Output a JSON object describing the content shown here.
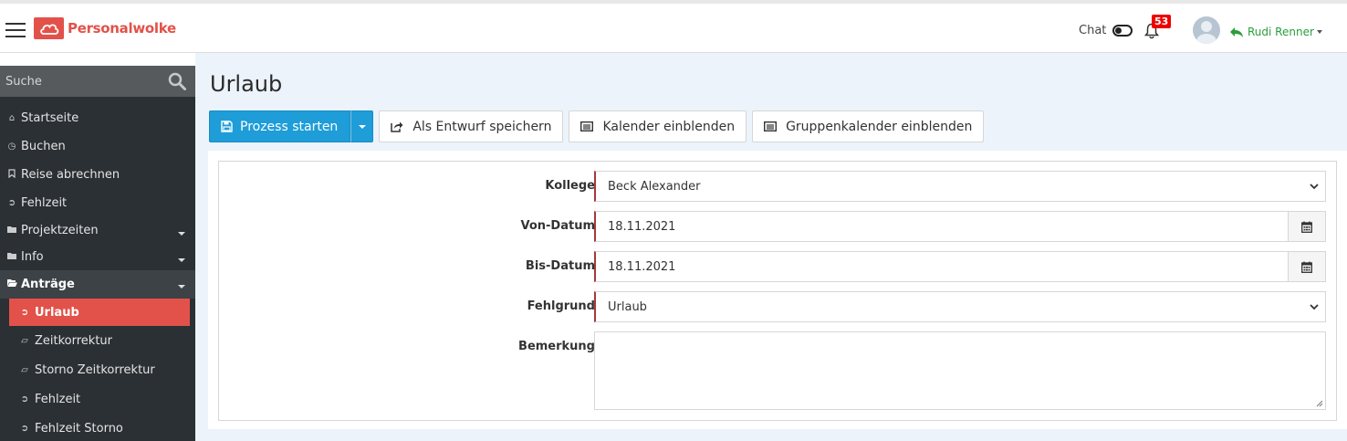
{
  "header": {
    "brand": "Personalwolke",
    "chat_label": "Chat",
    "notification_count": "53",
    "user_name": "Rudi Renner"
  },
  "sidebar": {
    "search_placeholder": "Suche",
    "items": [
      {
        "label": "Startseite",
        "icon": "home-icon"
      },
      {
        "label": "Buchen",
        "icon": "clock-icon"
      },
      {
        "label": "Reise abrechnen",
        "icon": "bookmark-icon"
      },
      {
        "label": "Fehlzeit",
        "icon": "sign-out-icon"
      },
      {
        "label": "Projektzeiten",
        "icon": "folder-icon"
      },
      {
        "label": "Info",
        "icon": "folder-icon"
      },
      {
        "label": "Anträge",
        "icon": "folder-open-icon"
      }
    ],
    "subitems": [
      {
        "label": "Urlaub",
        "icon": "sign-out-icon",
        "active": true
      },
      {
        "label": "Zeitkorrektur",
        "icon": "eraser-icon"
      },
      {
        "label": "Storno Zeitkorrektur",
        "icon": "eraser-icon"
      },
      {
        "label": "Fehlzeit",
        "icon": "sign-out-icon"
      },
      {
        "label": "Fehlzeit Storno",
        "icon": "sign-out-icon"
      }
    ]
  },
  "main": {
    "title": "Urlaub",
    "toolbar": {
      "start_label": "Prozess starten",
      "draft_label": "Als Entwurf speichern",
      "calendar_label": "Kalender einblenden",
      "group_calendar_label": "Gruppenkalender einblenden"
    },
    "form": {
      "colleague_label": "Kollege",
      "colleague_value": "Beck Alexander",
      "from_label": "Von-Datum",
      "from_value": "18.11.2021",
      "to_label": "Bis-Datum",
      "to_value": "18.11.2021",
      "reason_label": "Fehlgrund",
      "reason_value": "Urlaub",
      "remark_label": "Bemerkung",
      "remark_value": ""
    }
  },
  "colors": {
    "brand": "#e2524a",
    "primary": "#1e9dd8",
    "sidebar_bg": "#2b3034",
    "user_green": "#2a9d3a"
  }
}
